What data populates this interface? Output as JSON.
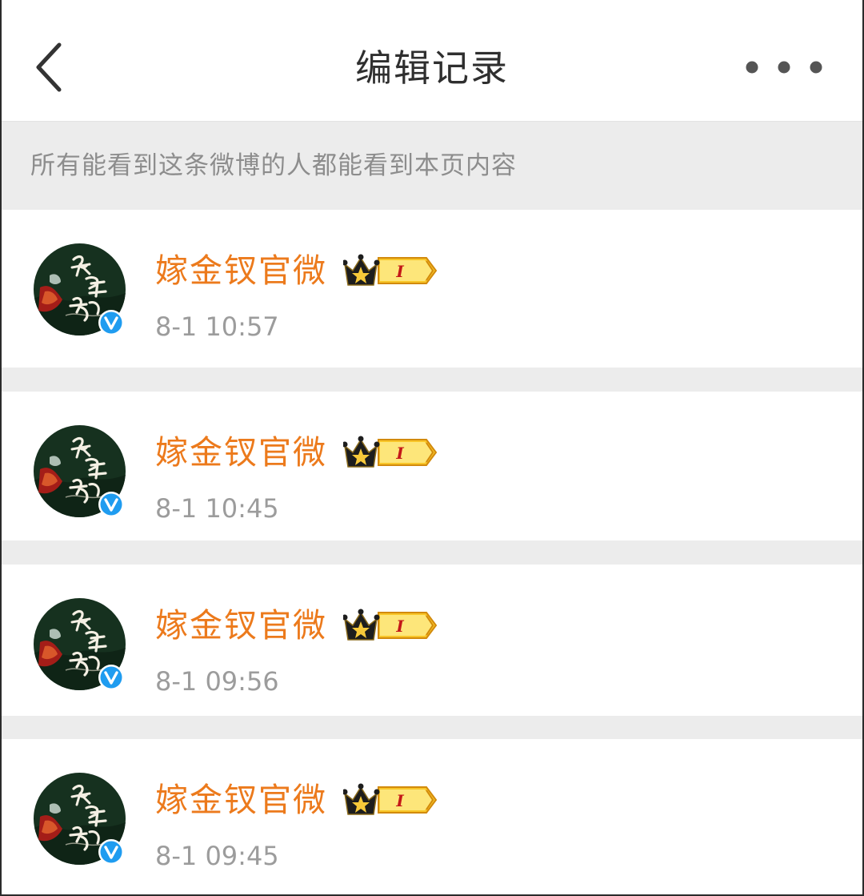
{
  "header": {
    "title": "编辑记录",
    "back_icon": "chevron-left-icon",
    "more_icon": "more-dots-icon"
  },
  "notice": {
    "text": "所有能看到这条微博的人都能看到本页内容"
  },
  "colors": {
    "username": "#ec7a1c",
    "timestamp": "#9c9c9c",
    "verified": "#1f9cf0"
  },
  "records": [
    {
      "username": "嫁金钗官微",
      "timestamp": "8-1 10:57",
      "badge_level": "I"
    },
    {
      "username": "嫁金钗官微",
      "timestamp": "8-1 10:45",
      "badge_level": "I"
    },
    {
      "username": "嫁金钗官微",
      "timestamp": "8-1 09:56",
      "badge_level": "I"
    },
    {
      "username": "嫁金钗官微",
      "timestamp": "8-1 09:45",
      "badge_level": "I"
    }
  ]
}
